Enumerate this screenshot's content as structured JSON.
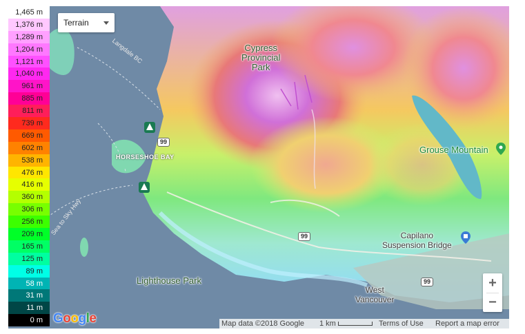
{
  "map_type_control": {
    "selected": "Terrain"
  },
  "legend": [
    {
      "label": "1,465 m",
      "color": "#ffffff",
      "text": "#222222"
    },
    {
      "label": "1,376 m",
      "color": "#ffc8ff",
      "text": "#222222"
    },
    {
      "label": "1,289 m",
      "color": "#ffa0ff",
      "text": "#222222"
    },
    {
      "label": "1,204 m",
      "color": "#ff78ff",
      "text": "#222222"
    },
    {
      "label": "1,121 m",
      "color": "#ff50ff",
      "text": "#222222"
    },
    {
      "label": "1,040 m",
      "color": "#ff28f0",
      "text": "#222222"
    },
    {
      "label": "961 m",
      "color": "#ff14c8",
      "text": "#222222"
    },
    {
      "label": "885 m",
      "color": "#ff0096",
      "text": "#222222"
    },
    {
      "label": "811 m",
      "color": "#ff1e5a",
      "text": "#222222"
    },
    {
      "label": "739 m",
      "color": "#ff2a1e",
      "text": "#222222"
    },
    {
      "label": "669 m",
      "color": "#ff5a00",
      "text": "#222222"
    },
    {
      "label": "602 m",
      "color": "#ff8200",
      "text": "#222222"
    },
    {
      "label": "538 m",
      "color": "#ffb400",
      "text": "#222222"
    },
    {
      "label": "476 m",
      "color": "#ffe600",
      "text": "#222222"
    },
    {
      "label": "416 m",
      "color": "#e6ff00",
      "text": "#222222"
    },
    {
      "label": "360 m",
      "color": "#b4ff00",
      "text": "#222222"
    },
    {
      "label": "306 m",
      "color": "#78ff00",
      "text": "#222222"
    },
    {
      "label": "256 m",
      "color": "#3cff00",
      "text": "#222222"
    },
    {
      "label": "209 m",
      "color": "#00ff28",
      "text": "#222222"
    },
    {
      "label": "165 m",
      "color": "#00ff64",
      "text": "#222222"
    },
    {
      "label": "125 m",
      "color": "#00ffa0",
      "text": "#222222"
    },
    {
      "label": "89 m",
      "color": "#00ffe6",
      "text": "#222222"
    },
    {
      "label": "58 m",
      "color": "#00b4b4",
      "text": "#ffffff"
    },
    {
      "label": "31 m",
      "color": "#007878",
      "text": "#ffffff"
    },
    {
      "label": "11 m",
      "color": "#004646",
      "text": "#ffffff"
    },
    {
      "label": "0 m",
      "color": "#000000",
      "text": "#ffffff"
    }
  ],
  "places": {
    "cypress_park": "Cypress\nProvincial\nPark",
    "horseshoe_bay": "HORSESHOE BAY",
    "grouse_mountain": "Grouse Mountain",
    "capilano": "Capilano\nSuspension Bridge",
    "lighthouse_park": "Lighthouse Park",
    "west_vancouver": "West\nVancouver",
    "langdale": "Langdale BC",
    "sea_hwy": "Sea to Sky Hwy",
    "highway_99": "99"
  },
  "footer": {
    "map_data": "Map data ©2018 Google",
    "scale": "1 km",
    "terms": "Terms of Use",
    "report": "Report a map error"
  },
  "zoom": {
    "in": "+",
    "out": "−"
  },
  "google_logo": [
    "G",
    "o",
    "o",
    "g",
    "l",
    "e"
  ],
  "google_colors": [
    "#4285f4",
    "#ea4335",
    "#fbbc05",
    "#4285f4",
    "#34a853",
    "#ea4335"
  ],
  "icons": {
    "park_poi": "park-icon",
    "grouse_poi": "map-pin-icon",
    "attraction_poi": "attraction-icon"
  }
}
